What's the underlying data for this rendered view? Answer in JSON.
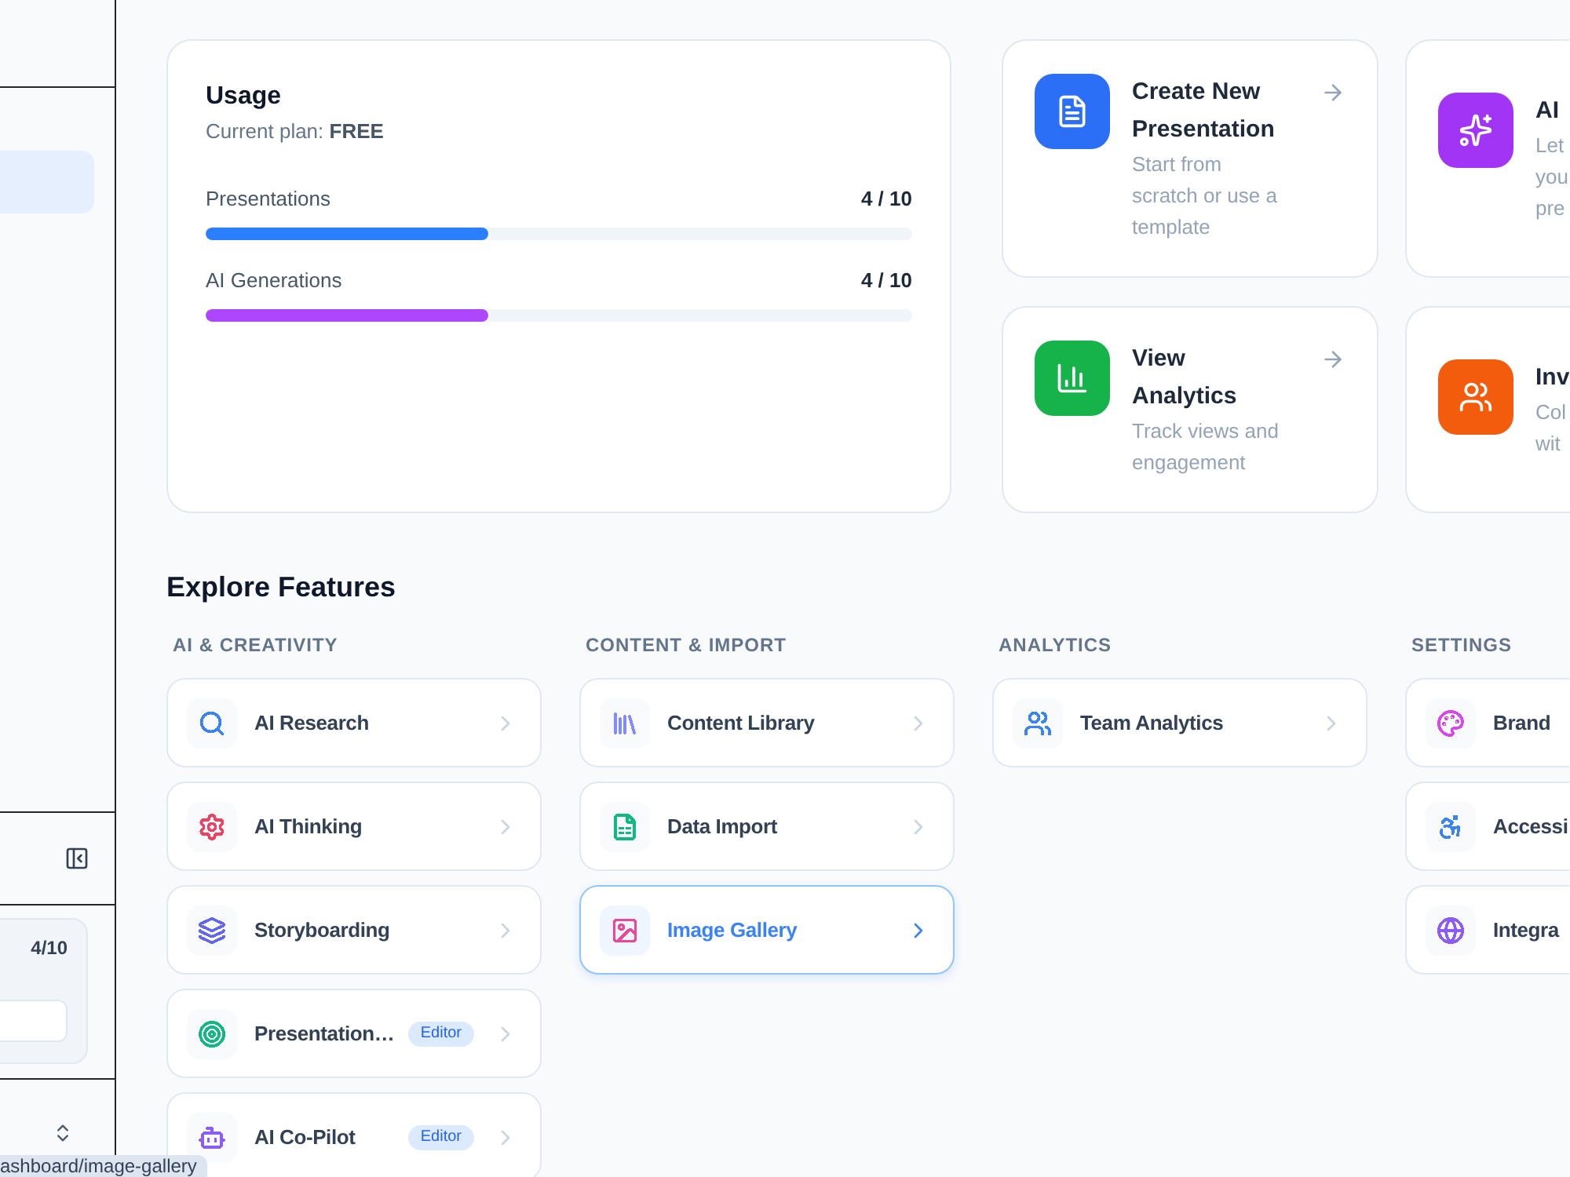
{
  "sidebar": {
    "items": [
      {
        "selected": true
      }
    ],
    "usage_count": "4/10"
  },
  "usage": {
    "title": "Usage",
    "subtitle": "Current plan: **FREE**",
    "meters": [
      {
        "label": "Presentations",
        "reading": "4 / 10",
        "level": 0.4,
        "color": "#2b7fff"
      },
      {
        "label": "AI Generations",
        "reading": "4 / 10",
        "level": 0.4,
        "color": "#ad46ff"
      }
    ]
  },
  "quick_actions": [
    {
      "title": "Create New Presentation",
      "description": "Start from scratch or use a template",
      "color": "#2b6ff7"
    },
    {
      "title": "AI",
      "description": "Let you pre",
      "color": "#a234f5"
    },
    {
      "title": "View Analytics",
      "description": "Track views and engagement",
      "color": "#16b34a"
    },
    {
      "title": "Inv",
      "description": "Col wit",
      "color": "#f25c0c"
    }
  ],
  "explore": {
    "title": "Explore Features",
    "sections": [
      {
        "heading": "AI & CREATIVITY",
        "items": [
          {
            "label": "AI Research",
            "color": "#3b82f6",
            "selected": false
          },
          {
            "label": "AI Thinking",
            "color": "#f43f5e",
            "selected": false
          },
          {
            "label": "Storyboarding",
            "color": "#6366f1",
            "selected": false
          },
          {
            "label": "Presentation…",
            "badge": "Editor",
            "color": "#10b981",
            "selected": false
          },
          {
            "label": "AI Co-Pilot",
            "badge": "Editor",
            "color": "#8b5cf6",
            "selected": false
          }
        ]
      },
      {
        "heading": "CONTENT & IMPORT",
        "items": [
          {
            "label": "Content Library",
            "color": "#818cf8",
            "selected": false
          },
          {
            "label": "Data Import",
            "color": "#10b981",
            "selected": false
          },
          {
            "label": "Image Gallery",
            "color": "#ec4899",
            "selected": true
          }
        ]
      },
      {
        "heading": "ANALYTICS",
        "items": [
          {
            "label": "Team Analytics",
            "color": "#3b82f6",
            "selected": false
          }
        ]
      },
      {
        "heading": "SETTINGS",
        "items": [
          {
            "label": "Brand",
            "color": "#d946ef",
            "selected": false
          },
          {
            "label": "Accessi",
            "color": "#3b82f6",
            "selected": false
          },
          {
            "label": "Integra",
            "color": "#8b5cf6",
            "selected": false
          }
        ]
      }
    ]
  },
  "status_url": "ashboard/image-gallery"
}
